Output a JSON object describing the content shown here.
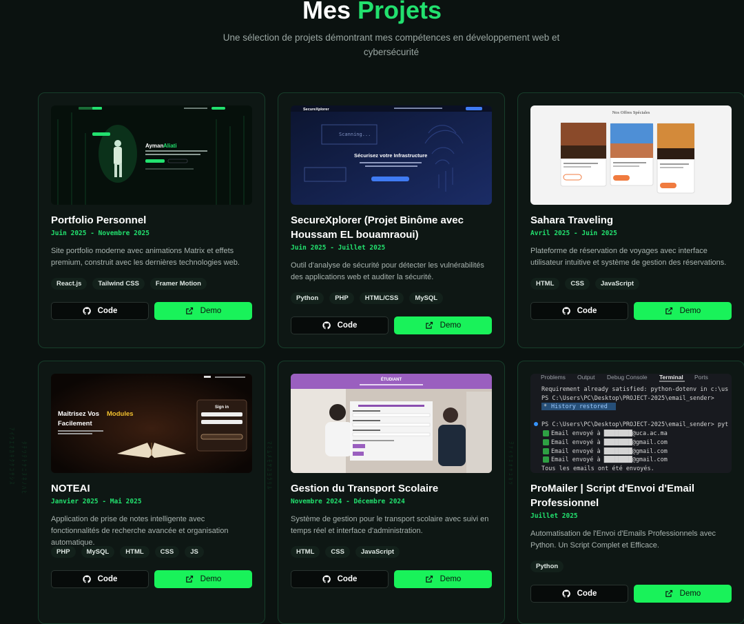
{
  "section": {
    "title_prefix": "Mes",
    "title_accent": "Projets",
    "subtitle": "Une sélection de projets démontrant mes compétences en développement web et cybersécurité"
  },
  "buttons": {
    "code_label": "Code",
    "demo_label": "Demo"
  },
  "colors": {
    "accent": "#22e06e",
    "demo_button": "#19f25a",
    "background": "#0b1210",
    "card": "#0e1714"
  },
  "projects": [
    {
      "title": "Portfolio Personnel",
      "date": "Juin 2025 - Novembre 2025",
      "description": "Site portfolio moderne avec animations Matrix et effets premium, construit avec les dernières technologies web.",
      "tags": [
        "React.js",
        "Tailwind CSS",
        "Framer Motion"
      ],
      "preview": {
        "name_first": "Ayman",
        "name_last": "Aliati"
      }
    },
    {
      "title": "SecureXplorer (Projet Binôme avec Houssam EL bouamraoui)",
      "date": "Juin 2025 - Juillet 2025",
      "description": "Outil d'analyse de sécurité pour détecter les vulnérabilités des applications web et auditer la sécurité.",
      "tags": [
        "Python",
        "PHP",
        "HTML/CSS",
        "MySQL"
      ],
      "preview": {
        "brand": "SecureXplorer",
        "scanning": "Scanning...",
        "headline": "Sécurisez votre Infrastructure"
      }
    },
    {
      "title": "Sahara Traveling",
      "date": "Avril 2025 - Juin 2025",
      "description": "Plateforme de réservation de voyages avec interface utilisateur intuitive et système de gestion des réservations.",
      "tags": [
        "HTML",
        "CSS",
        "JavaScript"
      ],
      "preview": {
        "heading": "Nos Offres Spéciales"
      }
    },
    {
      "title": "NOTEAI",
      "date": "Janvier 2025 - Mai 2025",
      "description": "Application de prise de notes intelligente avec fonctionnalités de recherche avancée et organisation automatique.",
      "tags": [
        "PHP",
        "MySQL",
        "HTML",
        "CSS",
        "JS"
      ],
      "preview": {
        "line1": "Maîtrisez Vos",
        "line1_accent": "Modules",
        "line2": "Facilement",
        "signin": "Sign in"
      }
    },
    {
      "title": "Gestion du Transport Scolaire",
      "date": "Novembre 2024 - Décembre 2024",
      "description": "Système de gestion pour le transport scolaire avec suivi en temps réel et interface d'administration.",
      "tags": [
        "HTML",
        "CSS",
        "JavaScript"
      ],
      "preview": {
        "banner": "ÉTUDIANT"
      }
    },
    {
      "title": "ProMailer | Script d'Envoi d'Email Professionnel",
      "date": "Juillet 2025",
      "description": "Automatisation de l'Envoi d'Emails Professionnels avec Python. Un Script Complet et Efficace.",
      "tags": [
        "Python"
      ],
      "preview": {
        "tabs": [
          "Problems",
          "Output",
          "Debug Console",
          "Terminal",
          "Ports"
        ],
        "lines": [
          "Requirement already satisfied: python-dotenv in c:\\us",
          "PS C:\\Users\\PC\\Desktop\\PROJECT-2025\\email_sender>",
          "History restored",
          "PS C:\\Users\\PC\\Desktop\\PROJECT-2025\\email_sender> pyt",
          "Email envoyé à ████████@uca.ac.ma",
          "Email envoyé à ████████@gmail.com",
          "Email envoyé à ████████@gmail.com",
          "Email envoyé à ████████@gmail.com",
          "Tous les emails ont été envoyés."
        ]
      }
    }
  ]
}
